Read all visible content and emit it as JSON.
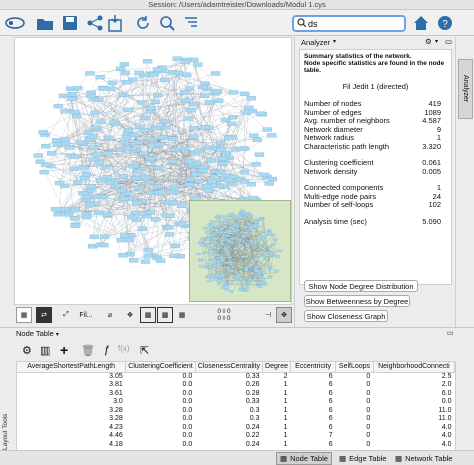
{
  "window": {
    "title": "Session: /Users/adamtreister/Downloads/Modul 1.cys"
  },
  "toolbar": {
    "search_value": "ds",
    "icons": [
      "logo-icon",
      "open-icon",
      "save-icon",
      "network-icon",
      "import-table-icon",
      "refresh-icon",
      "zoom-icon",
      "export-icon",
      "search-icon",
      "home-icon",
      "help-icon"
    ]
  },
  "analyzer": {
    "header": "Analyzer",
    "summary_line1": "Summary statistics of the network.",
    "summary_line2": "Node specific statistics are found in the node table.",
    "network_name": "Fil Jedit 1 (directed)",
    "stats_group1": [
      {
        "label": "Number of nodes",
        "value": "419"
      },
      {
        "label": "Number of edges",
        "value": "1089"
      },
      {
        "label": "Avg. number of neighbors",
        "value": "4.587"
      },
      {
        "label": "Network diameter",
        "value": "9"
      },
      {
        "label": "Network radius",
        "value": "1"
      },
      {
        "label": "Characteristic path length",
        "value": "3.320"
      }
    ],
    "stats_group2": [
      {
        "label": "Clustering coefficient",
        "value": "0.061"
      },
      {
        "label": "Network density",
        "value": "0.005"
      }
    ],
    "stats_group3": [
      {
        "label": "Connected components",
        "value": "1"
      },
      {
        "label": "Multi-edge node pairs",
        "value": "24"
      },
      {
        "label": "Number of self-loops",
        "value": "102"
      }
    ],
    "stats_group4": [
      {
        "label": "Analysis time (sec)",
        "value": "5.090"
      }
    ],
    "btn_degree": "Show Node Degree Distribution",
    "btn_betweenness": "Show Betweenness by Degree",
    "btn_closeness": "Show Closeness Graph",
    "side_tab": "Analyzer"
  },
  "canvas_toolbar": {
    "fil_label": "Fil...",
    "coord1": "0",
    "coord2": "0",
    "coord3": "0",
    "coord4": "0"
  },
  "node_table": {
    "header": "Node Table",
    "columns": [
      "AverageShortestPathLength",
      "ClusteringCoefficient",
      "ClosenessCentrality",
      "Degree",
      "Eccentricity",
      "SelfLoops",
      "NeighborhoodConnecti"
    ],
    "rows": [
      [
        "3.05",
        "0.0",
        "0.33",
        "2",
        "6",
        "0",
        "2.5"
      ],
      [
        "3.81",
        "0.0",
        "0.26",
        "1",
        "6",
        "0",
        "2.0"
      ],
      [
        "3.61",
        "0.0",
        "0.28",
        "1",
        "6",
        "0",
        "6.0"
      ],
      [
        "3.0",
        "0.0",
        "0.33",
        "1",
        "6",
        "0",
        "0.0"
      ],
      [
        "3.28",
        "0.0",
        "0.3",
        "1",
        "6",
        "0",
        "11.0"
      ],
      [
        "3.28",
        "0.0",
        "0.3",
        "1",
        "6",
        "0",
        "11.0"
      ],
      [
        "4.23",
        "0.0",
        "0.24",
        "1",
        "6",
        "0",
        "4.0"
      ],
      [
        "4.46",
        "0.0",
        "0.22",
        "1",
        "7",
        "0",
        "4.0"
      ],
      [
        "4.18",
        "0.0",
        "0.24",
        "1",
        "6",
        "0",
        "4.0"
      ]
    ]
  },
  "bottom_tabs": {
    "node": "Node Table",
    "edge": "Edge Table",
    "network": "Network Table"
  },
  "side_label": "Layout Tools",
  "colors": {
    "node": "#a9d8f0",
    "minimap_bg": "#d7e7c6",
    "search_border": "#6fa4e4"
  }
}
